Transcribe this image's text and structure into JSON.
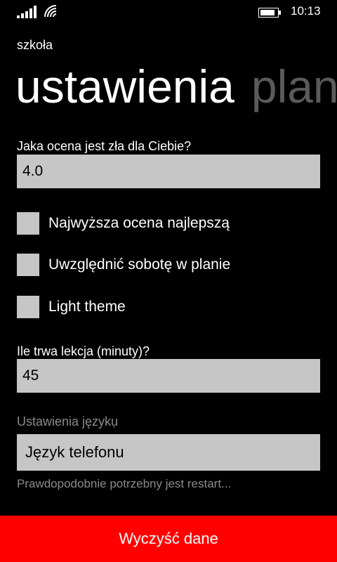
{
  "status_bar": {
    "time": "10:13",
    "icons": [
      "signal-strength-icon",
      "wifi-icon",
      "battery-icon"
    ]
  },
  "app": {
    "title": "szkoła"
  },
  "pivot": {
    "current": "ustawienia",
    "next": "plan"
  },
  "settings": {
    "bad_grade_label": "Jaka ocena jest zła dla Ciebie?",
    "bad_grade_value": "4.0",
    "checkboxes": [
      {
        "label": "Najwyższa ocena najlepszą",
        "checked": false
      },
      {
        "label": "Uwzględnić sobotę w planie",
        "checked": false
      },
      {
        "label": "Light theme",
        "checked": false
      }
    ],
    "lesson_length_label": "Ile trwa lekcja (minuty)?",
    "lesson_length_value": "45",
    "language_label": "Ustawienia językụ",
    "language_value": "Język telefonu",
    "restart_hint": "Prawdopodobnie potrzebny jest restart..."
  },
  "actions": {
    "clear_label": "Wyczyść dane"
  },
  "colors": {
    "background": "#000000",
    "input_fill": "#c6c6c6",
    "accent_red": "#ff0000",
    "dim_text": "#8a8a8a",
    "pivot_inactive": "#5a5a5a"
  }
}
